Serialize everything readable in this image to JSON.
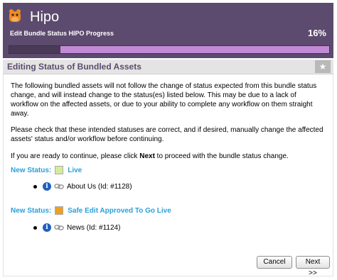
{
  "app": {
    "title": "Hipo",
    "progress_label": "Edit Bundle Status HIPO Progress",
    "progress_percent": "16%",
    "progress_fraction": 0.16
  },
  "section": {
    "title": "Editing Status of Bundled Assets",
    "star_icon": "star-icon"
  },
  "content": {
    "para1": "The following bundled assets will not follow the change of status expected from this bundle status change, and will instead change to the status(es) listed below. This may be due to a lack of workflow on the affected assets, or due to your ability to complete any workflow on them straight away.",
    "para2": "Please check that these intended statuses are correct, and if desired, manually change the affected assets' status and/or workflow before continuing.",
    "para3_pre": "If you are ready to continue, please click ",
    "para3_bold": "Next",
    "para3_post": " to proceed with the bundle status change.",
    "groups": [
      {
        "label": "New Status:",
        "status": "Live",
        "color": "#d6ec9b",
        "items": [
          {
            "text": "About Us (Id: #1128)"
          }
        ]
      },
      {
        "label": "New Status:",
        "status": "Safe Edit Approved To Go Live",
        "color": "#f0a020",
        "items": [
          {
            "text": "News (Id: #1124)"
          }
        ]
      }
    ]
  },
  "buttons": {
    "cancel": "Cancel",
    "next": "Next >>"
  }
}
